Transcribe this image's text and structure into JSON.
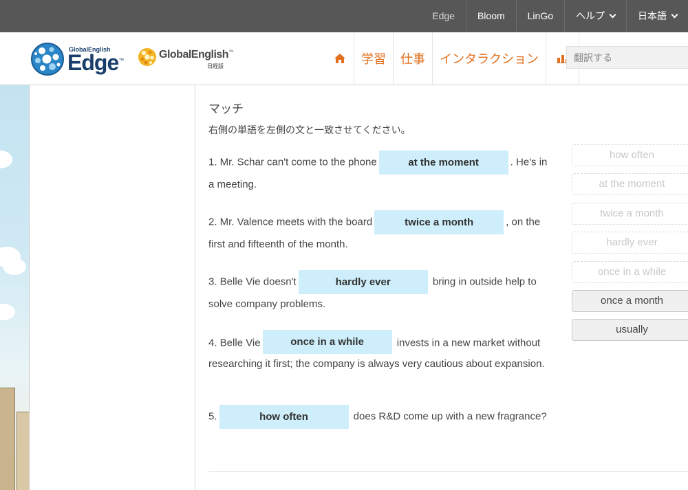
{
  "topnav": {
    "edge": "Edge",
    "bloom": "Bloom",
    "lingo": "LinGo",
    "help": "ヘルプ",
    "language": "日本語"
  },
  "logos": {
    "edge_small": "GlobalEnglish",
    "edge_big": "Edge",
    "edge_tm": "™",
    "ge_name": "GlobalEnglish",
    "ge_tm": "™",
    "ge_sub": "日経版"
  },
  "mainnav": {
    "home_icon": "home-icon",
    "learn": "学習",
    "work": "仕事",
    "interaction": "インタラクション",
    "stats_icon": "bar-chart-icon"
  },
  "search": {
    "placeholder": "翻訳する"
  },
  "exercise": {
    "title": "マッチ",
    "instruction": "右側の単語を左側の文と一致させてください。",
    "questions": [
      {
        "before": "1. Mr. Schar can't come to the phone",
        "answer": "at the moment",
        "after": ". He's in a meeting."
      },
      {
        "before": "2. Mr. Valence meets with the board",
        "answer": "twice a month",
        "after": ", on the first and fifteenth of the month."
      },
      {
        "before": "3. Belle Vie doesn't",
        "answer": "hardly ever",
        "after": " bring in outside help to solve company problems."
      },
      {
        "before": "4. Belle Vie",
        "answer": "once in a while",
        "after": " invests in a new market without researching it first; the company is always very cautious about expansion."
      },
      {
        "before": "5.",
        "answer": "how often",
        "after": " does R&D come up with a new fragrance?"
      }
    ],
    "options": [
      {
        "label": "how often",
        "state": "used"
      },
      {
        "label": "at the moment",
        "state": "used"
      },
      {
        "label": "twice a month",
        "state": "used"
      },
      {
        "label": "hardly ever",
        "state": "used"
      },
      {
        "label": "once in a while",
        "state": "used"
      },
      {
        "label": "once a month",
        "state": "available"
      },
      {
        "label": "usually",
        "state": "available"
      }
    ]
  },
  "colors": {
    "topbar": "#575757",
    "accent_orange": "#e0701e",
    "blank_fill": "#cdeefa",
    "brand_blue": "#1a3e6b"
  }
}
